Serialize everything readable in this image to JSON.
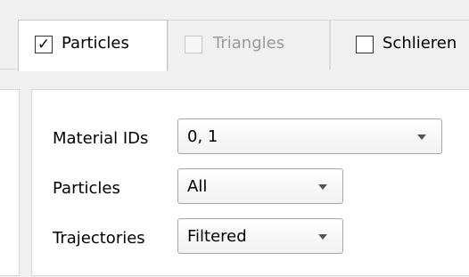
{
  "tabs": [
    {
      "label": "Particles",
      "checked": true,
      "enabled": true,
      "active": true
    },
    {
      "label": "Triangles",
      "checked": false,
      "enabled": false,
      "active": false
    },
    {
      "label": "Schlieren",
      "checked": false,
      "enabled": true,
      "active": false
    }
  ],
  "check_glyph": "✓",
  "fields": {
    "material_ids": {
      "label": "Material IDs",
      "value": "0, 1"
    },
    "particles": {
      "label": "Particles",
      "value": "All"
    },
    "trajectories": {
      "label": "Trajectories",
      "value": "Filtered"
    }
  }
}
